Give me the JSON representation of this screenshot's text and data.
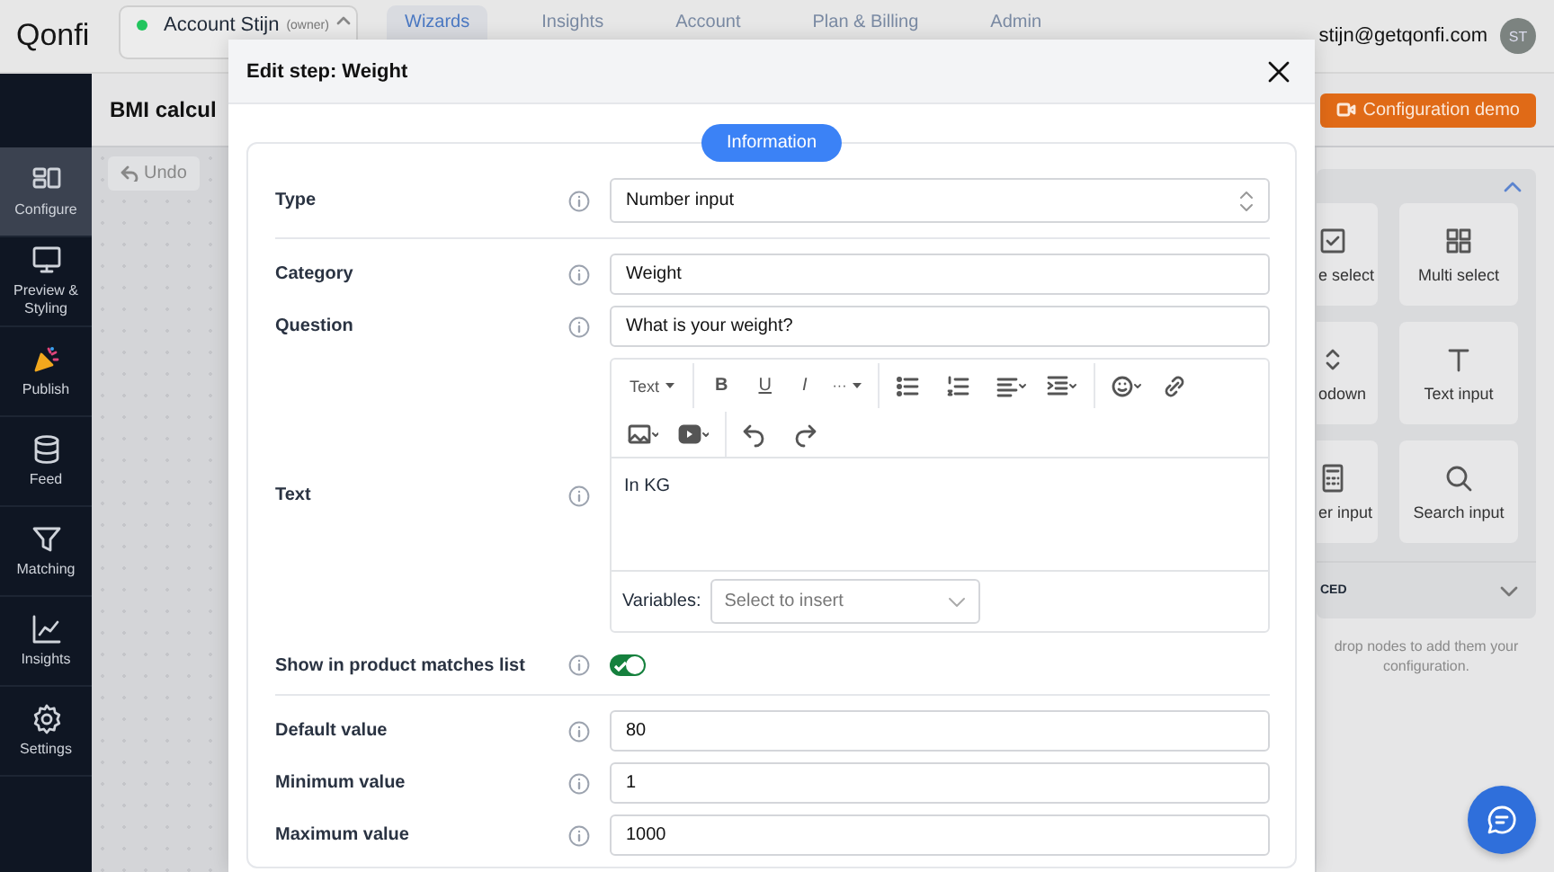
{
  "header": {
    "logo": "Qonfi",
    "account": {
      "name": "Account Stijn",
      "role": "(owner)",
      "color": "#22c55e"
    },
    "nav": [
      {
        "label": "Wizards",
        "selected": true
      },
      {
        "label": "Insights",
        "selected": false
      },
      {
        "label": "Account",
        "selected": false
      },
      {
        "label": "Plan & Billing",
        "selected": false
      },
      {
        "label": "Admin",
        "selected": false
      }
    ],
    "email": "stijn@getqonfi.com",
    "avatar": "ST"
  },
  "sidebar": {
    "items": [
      {
        "kind": "configure",
        "label": "Configure",
        "selected": true
      },
      {
        "kind": "preview",
        "label": "Preview & Styling",
        "selected": false
      },
      {
        "kind": "publish",
        "label": "Publish",
        "selected": false
      },
      {
        "kind": "feed",
        "label": "Feed",
        "selected": false
      },
      {
        "kind": "matching",
        "label": "Matching",
        "selected": false
      },
      {
        "kind": "insights",
        "label": "Insights",
        "selected": false
      },
      {
        "kind": "settings",
        "label": "Settings",
        "selected": false
      }
    ]
  },
  "page": {
    "title": "BMI calcul",
    "undo": "Undo",
    "demo_button": "Configuration demo"
  },
  "palette": {
    "expanded": true,
    "cards": [
      {
        "kind": "single",
        "label": "e select"
      },
      {
        "kind": "multi",
        "label": "Multi select"
      },
      {
        "kind": "dropdown",
        "label": "odown"
      },
      {
        "kind": "text",
        "label": "Text input"
      },
      {
        "kind": "number",
        "label": "er input"
      },
      {
        "kind": "search",
        "label": "Search input"
      }
    ],
    "section": {
      "label": "CED",
      "expanded": false
    },
    "hint": "drop nodes to add them your configuration."
  },
  "modal": {
    "title": "Edit step: Weight",
    "tab": "Information",
    "fields": [
      {
        "kind": "select",
        "label": "Type",
        "value": "Number input"
      },
      {
        "kind": "divider"
      },
      {
        "kind": "text",
        "label": "Category",
        "value": "Weight"
      },
      {
        "kind": "text",
        "label": "Question",
        "value": "What is your weight?"
      },
      {
        "kind": "editor",
        "label": "Text",
        "format": "Text",
        "marks": [
          "B",
          "U",
          "I"
        ],
        "more": "···",
        "content": "In KG",
        "variables_label": "Variables:",
        "placeholder": "Select to insert"
      },
      {
        "kind": "toggle",
        "label": "Show in product matches list",
        "on": true
      },
      {
        "kind": "divider"
      },
      {
        "kind": "text",
        "label": "Default value",
        "value": "80"
      },
      {
        "kind": "text",
        "label": "Minimum value",
        "value": "1"
      },
      {
        "kind": "text",
        "label": "Maximum value",
        "value": "1000"
      }
    ]
  }
}
